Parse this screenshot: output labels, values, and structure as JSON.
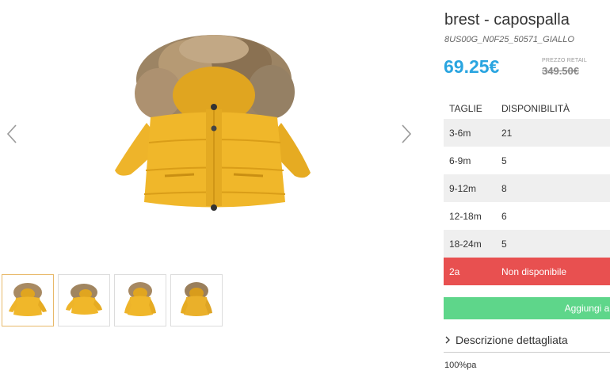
{
  "product": {
    "title": "brest - capospalla",
    "sku": "8US00G_N0F25_50571_GIALLO",
    "price": "69.25€",
    "retail_label": "PREZZO RETAIL",
    "retail_price": "349.50€",
    "colors": {
      "accent": "#2aa5e0",
      "jacket": "#f0b72a",
      "fur": "#a88a63",
      "unavailable": "#e85050",
      "add_button": "#5ed68a"
    }
  },
  "gallery": {
    "prev_icon": "chevron-left-icon",
    "next_icon": "chevron-right-icon",
    "thumbnail_count": 4,
    "active_thumbnail": 1
  },
  "sizes": {
    "header": {
      "size": "TAGLIE",
      "availability": "DISPONIBILITÀ"
    },
    "rows": [
      {
        "size": "3-6m",
        "availability": "21"
      },
      {
        "size": "6-9m",
        "availability": "5"
      },
      {
        "size": "9-12m",
        "availability": "8"
      },
      {
        "size": "12-18m",
        "availability": "6"
      },
      {
        "size": "18-24m",
        "availability": "5"
      },
      {
        "size": "2a",
        "availability": "Non disponibile"
      }
    ]
  },
  "add_to_cart": {
    "label": "Aggiungi al ca"
  },
  "description": {
    "toggle_label": "Descrizione dettagliata",
    "icon": "chevron-right-icon",
    "composition": "100%pa"
  }
}
